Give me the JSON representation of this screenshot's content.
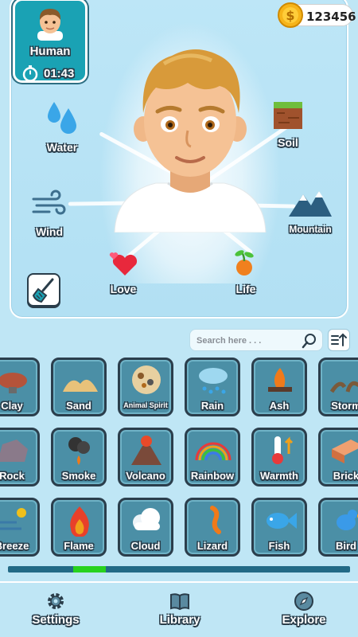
{
  "player": {
    "name": "Human",
    "timer": "01:43"
  },
  "currency": {
    "coins": "123456"
  },
  "central_element": {
    "name": "Human",
    "avatar": "human-man-avatar"
  },
  "recipe_ring": [
    {
      "label": "Water",
      "icon": "water-drops-icon"
    },
    {
      "label": "Soil",
      "icon": "soil-block-icon"
    },
    {
      "label": "Wind",
      "icon": "wind-icon"
    },
    {
      "label": "Mountain",
      "icon": "mountain-icon"
    },
    {
      "label": "Love",
      "icon": "hearts-icon"
    },
    {
      "label": "Life",
      "icon": "sprout-icon"
    }
  ],
  "search": {
    "placeholder": "Search here . . ."
  },
  "elements": [
    {
      "name": "Clay",
      "icon": "clay-icon"
    },
    {
      "name": "Sand",
      "icon": "sand-icon"
    },
    {
      "name": "Animal Spirit",
      "icon": "animal-spirit-icon"
    },
    {
      "name": "Rain",
      "icon": "rain-cloud-icon"
    },
    {
      "name": "Ash",
      "icon": "ash-fire-icon"
    },
    {
      "name": "Storm",
      "icon": "storm-icon"
    },
    {
      "name": "Rock",
      "icon": "rock-icon"
    },
    {
      "name": "Smoke",
      "icon": "smoke-icon"
    },
    {
      "name": "Volcano",
      "icon": "volcano-icon"
    },
    {
      "name": "Rainbow",
      "icon": "rainbow-icon"
    },
    {
      "name": "Warmth",
      "icon": "thermometer-icon"
    },
    {
      "name": "Brick",
      "icon": "brick-icon"
    },
    {
      "name": "Breeze",
      "icon": "breeze-icon"
    },
    {
      "name": "Flame",
      "icon": "flame-icon"
    },
    {
      "name": "Cloud",
      "icon": "cloud-icon"
    },
    {
      "name": "Lizard",
      "icon": "lizard-icon"
    },
    {
      "name": "Fish",
      "icon": "fish-icon"
    },
    {
      "name": "Bird",
      "icon": "bird-icon"
    }
  ],
  "scroll_progress": {
    "position": 0.19,
    "thumb_fraction": 0.095
  },
  "bottom_nav": {
    "settings": "Settings",
    "library": "Library",
    "explore": "Explore"
  },
  "colors": {
    "background": "#bfe6f5",
    "tile": "#4b8fa6",
    "progress_fill": "#28d21e",
    "accent": "#1aa2b4"
  }
}
